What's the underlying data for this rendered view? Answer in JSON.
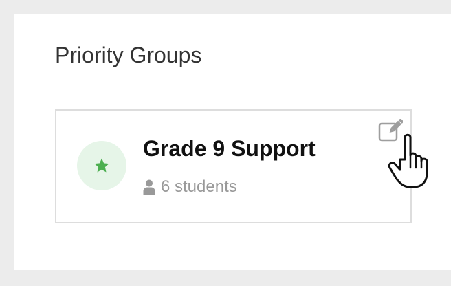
{
  "section": {
    "title": "Priority Groups"
  },
  "group_card": {
    "name": "Grade 9 Support",
    "student_count": "6 students",
    "avatar_icon": "star-icon",
    "meta_icon": "user-icon",
    "action_icon": "edit-icon"
  },
  "colors": {
    "accent_green": "#4caf50",
    "avatar_bg": "#e6f5e8",
    "muted_text": "#999999",
    "card_border": "#dddddd",
    "page_bg": "#ececec"
  },
  "cursor": {
    "type": "pointer-hand"
  }
}
